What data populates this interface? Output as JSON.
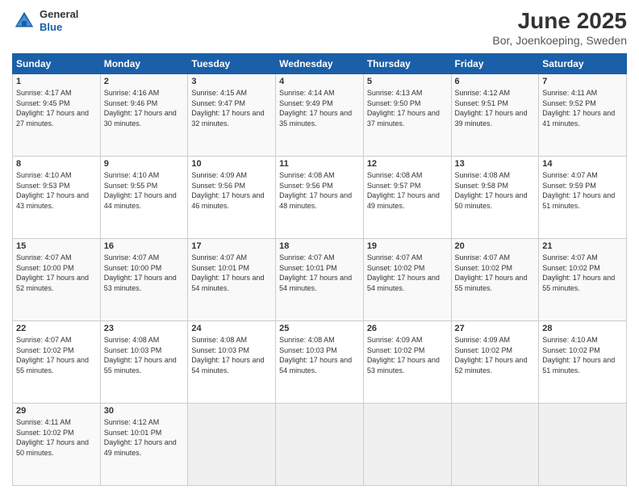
{
  "header": {
    "logo": {
      "general": "General",
      "blue": "Blue"
    },
    "title": "June 2025",
    "subtitle": "Bor, Joenkoeping, Sweden"
  },
  "days_of_week": [
    "Sunday",
    "Monday",
    "Tuesday",
    "Wednesday",
    "Thursday",
    "Friday",
    "Saturday"
  ],
  "weeks": [
    [
      {
        "day": "1",
        "sunrise": "4:17 AM",
        "sunset": "9:45 PM",
        "daylight": "17 hours and 27 minutes."
      },
      {
        "day": "2",
        "sunrise": "4:16 AM",
        "sunset": "9:46 PM",
        "daylight": "17 hours and 30 minutes."
      },
      {
        "day": "3",
        "sunrise": "4:15 AM",
        "sunset": "9:47 PM",
        "daylight": "17 hours and 32 minutes."
      },
      {
        "day": "4",
        "sunrise": "4:14 AM",
        "sunset": "9:49 PM",
        "daylight": "17 hours and 35 minutes."
      },
      {
        "day": "5",
        "sunrise": "4:13 AM",
        "sunset": "9:50 PM",
        "daylight": "17 hours and 37 minutes."
      },
      {
        "day": "6",
        "sunrise": "4:12 AM",
        "sunset": "9:51 PM",
        "daylight": "17 hours and 39 minutes."
      },
      {
        "day": "7",
        "sunrise": "4:11 AM",
        "sunset": "9:52 PM",
        "daylight": "17 hours and 41 minutes."
      }
    ],
    [
      {
        "day": "8",
        "sunrise": "4:10 AM",
        "sunset": "9:53 PM",
        "daylight": "17 hours and 43 minutes."
      },
      {
        "day": "9",
        "sunrise": "4:10 AM",
        "sunset": "9:55 PM",
        "daylight": "17 hours and 44 minutes."
      },
      {
        "day": "10",
        "sunrise": "4:09 AM",
        "sunset": "9:56 PM",
        "daylight": "17 hours and 46 minutes."
      },
      {
        "day": "11",
        "sunrise": "4:08 AM",
        "sunset": "9:56 PM",
        "daylight": "17 hours and 48 minutes."
      },
      {
        "day": "12",
        "sunrise": "4:08 AM",
        "sunset": "9:57 PM",
        "daylight": "17 hours and 49 minutes."
      },
      {
        "day": "13",
        "sunrise": "4:08 AM",
        "sunset": "9:58 PM",
        "daylight": "17 hours and 50 minutes."
      },
      {
        "day": "14",
        "sunrise": "4:07 AM",
        "sunset": "9:59 PM",
        "daylight": "17 hours and 51 minutes."
      }
    ],
    [
      {
        "day": "15",
        "sunrise": "4:07 AM",
        "sunset": "10:00 PM",
        "daylight": "17 hours and 52 minutes."
      },
      {
        "day": "16",
        "sunrise": "4:07 AM",
        "sunset": "10:00 PM",
        "daylight": "17 hours and 53 minutes."
      },
      {
        "day": "17",
        "sunrise": "4:07 AM",
        "sunset": "10:01 PM",
        "daylight": "17 hours and 54 minutes."
      },
      {
        "day": "18",
        "sunrise": "4:07 AM",
        "sunset": "10:01 PM",
        "daylight": "17 hours and 54 minutes."
      },
      {
        "day": "19",
        "sunrise": "4:07 AM",
        "sunset": "10:02 PM",
        "daylight": "17 hours and 54 minutes."
      },
      {
        "day": "20",
        "sunrise": "4:07 AM",
        "sunset": "10:02 PM",
        "daylight": "17 hours and 55 minutes."
      },
      {
        "day": "21",
        "sunrise": "4:07 AM",
        "sunset": "10:02 PM",
        "daylight": "17 hours and 55 minutes."
      }
    ],
    [
      {
        "day": "22",
        "sunrise": "4:07 AM",
        "sunset": "10:02 PM",
        "daylight": "17 hours and 55 minutes."
      },
      {
        "day": "23",
        "sunrise": "4:08 AM",
        "sunset": "10:03 PM",
        "daylight": "17 hours and 55 minutes."
      },
      {
        "day": "24",
        "sunrise": "4:08 AM",
        "sunset": "10:03 PM",
        "daylight": "17 hours and 54 minutes."
      },
      {
        "day": "25",
        "sunrise": "4:08 AM",
        "sunset": "10:03 PM",
        "daylight": "17 hours and 54 minutes."
      },
      {
        "day": "26",
        "sunrise": "4:09 AM",
        "sunset": "10:02 PM",
        "daylight": "17 hours and 53 minutes."
      },
      {
        "day": "27",
        "sunrise": "4:09 AM",
        "sunset": "10:02 PM",
        "daylight": "17 hours and 52 minutes."
      },
      {
        "day": "28",
        "sunrise": "4:10 AM",
        "sunset": "10:02 PM",
        "daylight": "17 hours and 51 minutes."
      }
    ],
    [
      {
        "day": "29",
        "sunrise": "4:11 AM",
        "sunset": "10:02 PM",
        "daylight": "17 hours and 50 minutes."
      },
      {
        "day": "30",
        "sunrise": "4:12 AM",
        "sunset": "10:01 PM",
        "daylight": "17 hours and 49 minutes."
      },
      null,
      null,
      null,
      null,
      null
    ]
  ]
}
